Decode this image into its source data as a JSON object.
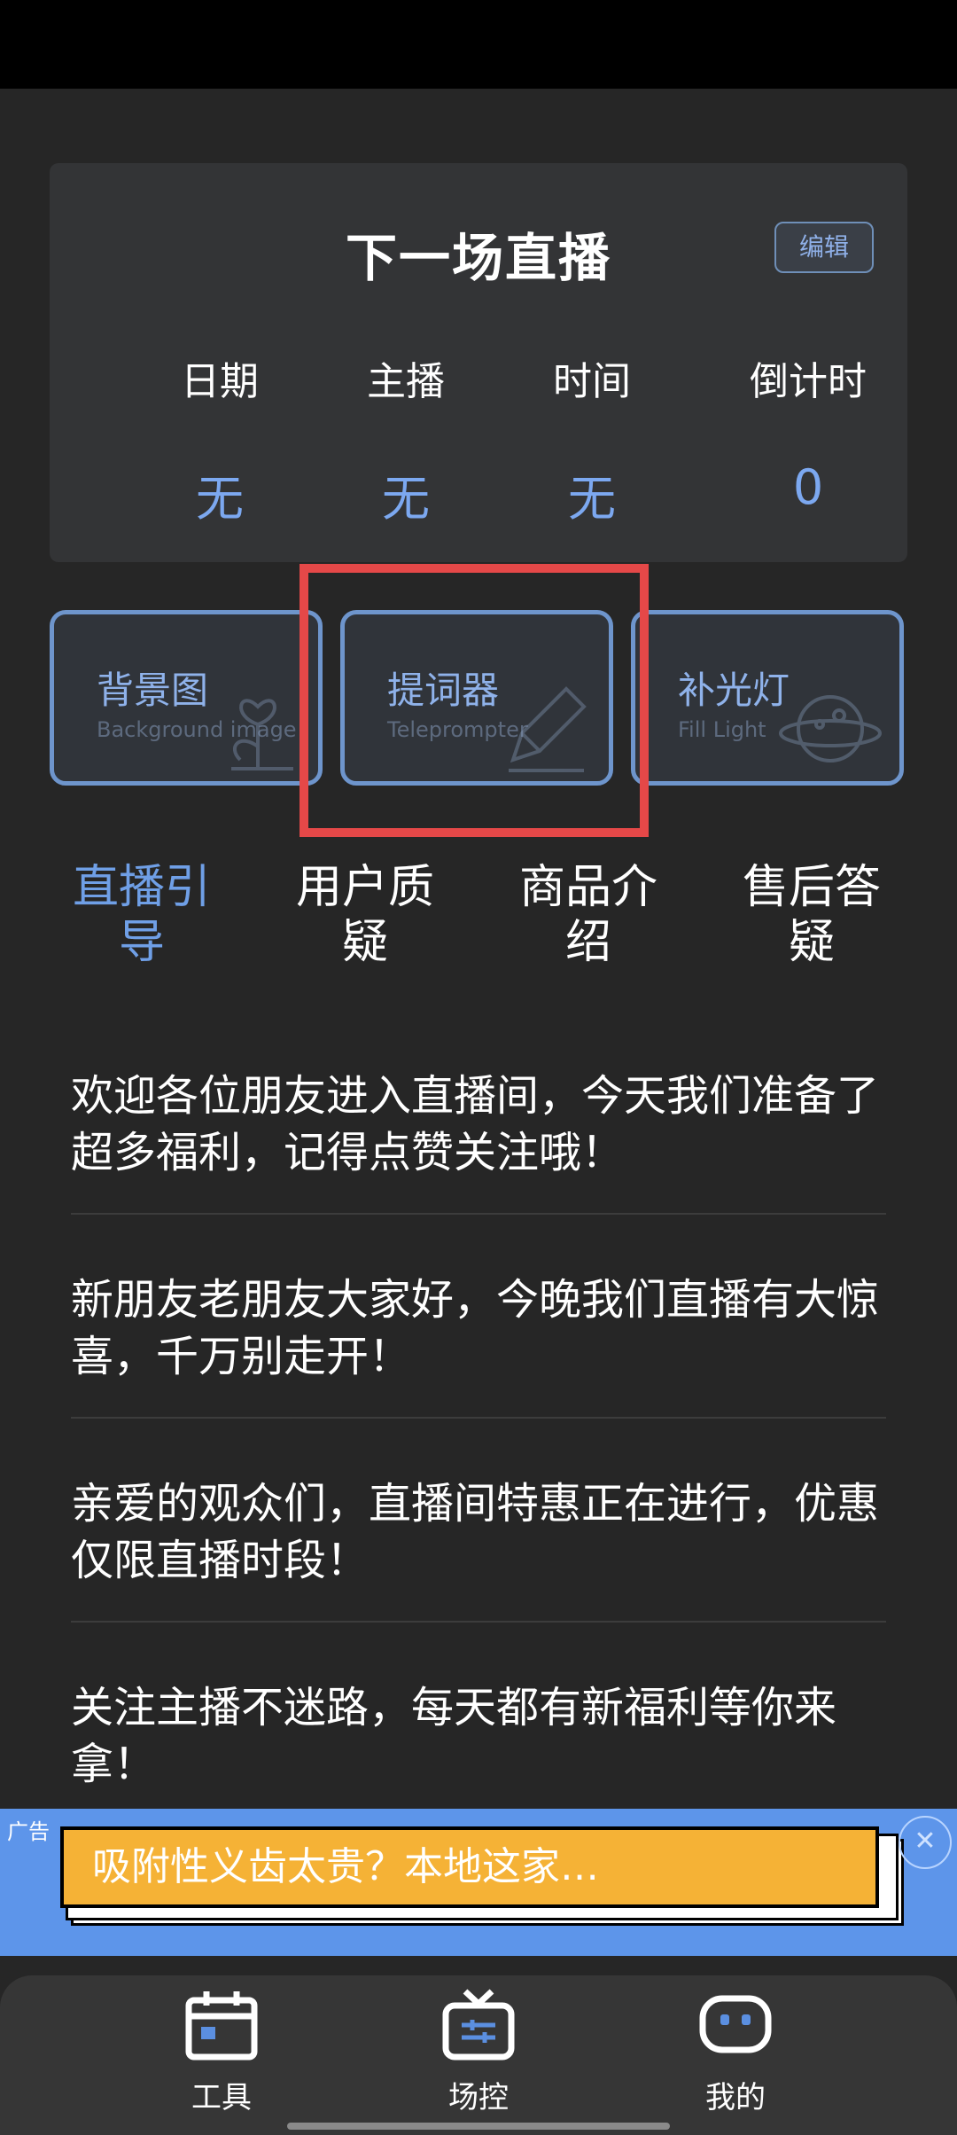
{
  "next_live": {
    "title": "下一场直播",
    "edit_label": "编辑",
    "fields": [
      {
        "label": "日期",
        "value": "无"
      },
      {
        "label": "主播",
        "value": "无"
      },
      {
        "label": "时间",
        "value": "无"
      },
      {
        "label": "倒计时",
        "value": "0"
      }
    ]
  },
  "tools": [
    {
      "title": "背景图",
      "subtitle": "Background image",
      "icon": "flower-icon"
    },
    {
      "title": "提词器",
      "subtitle": "Teleprompter",
      "icon": "pen-icon"
    },
    {
      "title": "补光灯",
      "subtitle": "Fill Light",
      "icon": "planet-icon"
    }
  ],
  "categories": [
    {
      "label": "直播引导",
      "active": true
    },
    {
      "label": "用户质疑",
      "active": false
    },
    {
      "label": "商品介绍",
      "active": false
    },
    {
      "label": "售后答疑",
      "active": false
    }
  ],
  "scripts": [
    "欢迎各位朋友进入直播间，今天我们准备了超多福利，记得点赞关注哦！",
    "新朋友老朋友大家好，今晚我们直播有大惊喜，千万别走开！",
    "亲爱的观众们，直播间特惠正在进行，优惠仅限直播时段！",
    "关注主播不迷路，每天都有新福利等你来拿！"
  ],
  "ad": {
    "label": "广告",
    "text": "吸附性义齿太贵？本地这家…",
    "close_icon": "close-icon"
  },
  "bottom_nav": [
    {
      "label": "工具",
      "icon": "calendar-icon"
    },
    {
      "label": "场控",
      "icon": "tv-control-icon"
    },
    {
      "label": "我的",
      "icon": "robot-face-icon"
    }
  ],
  "colors": {
    "background": "#262626",
    "accent": "#6f9fe6",
    "highlight": "#e54848",
    "ad_background": "#5d95ea",
    "ad_button": "#f5b236"
  }
}
